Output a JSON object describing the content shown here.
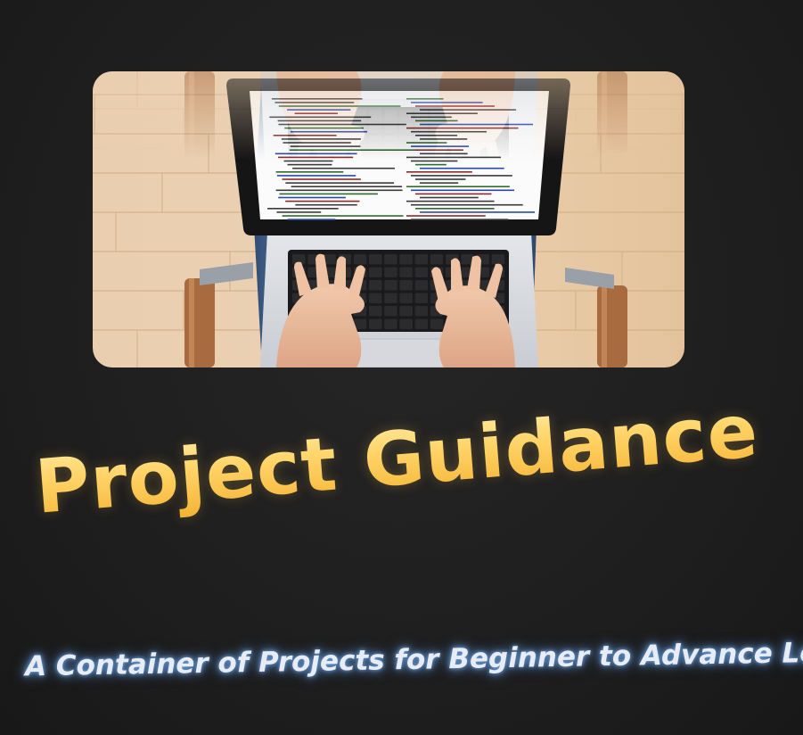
{
  "title": "Project Guidance",
  "subtitle": "A Container of Projects for Beginner to Advance Level",
  "photo": {
    "subject": "overhead view of hands typing on a laptop showing source code, on a light wooden floor"
  },
  "colors": {
    "background": "#202020",
    "title_gold": "#f5c24d",
    "subtitle_glow": "#5b8fcf",
    "wood": "#e8c9a4",
    "denim": "#3c5a82"
  }
}
